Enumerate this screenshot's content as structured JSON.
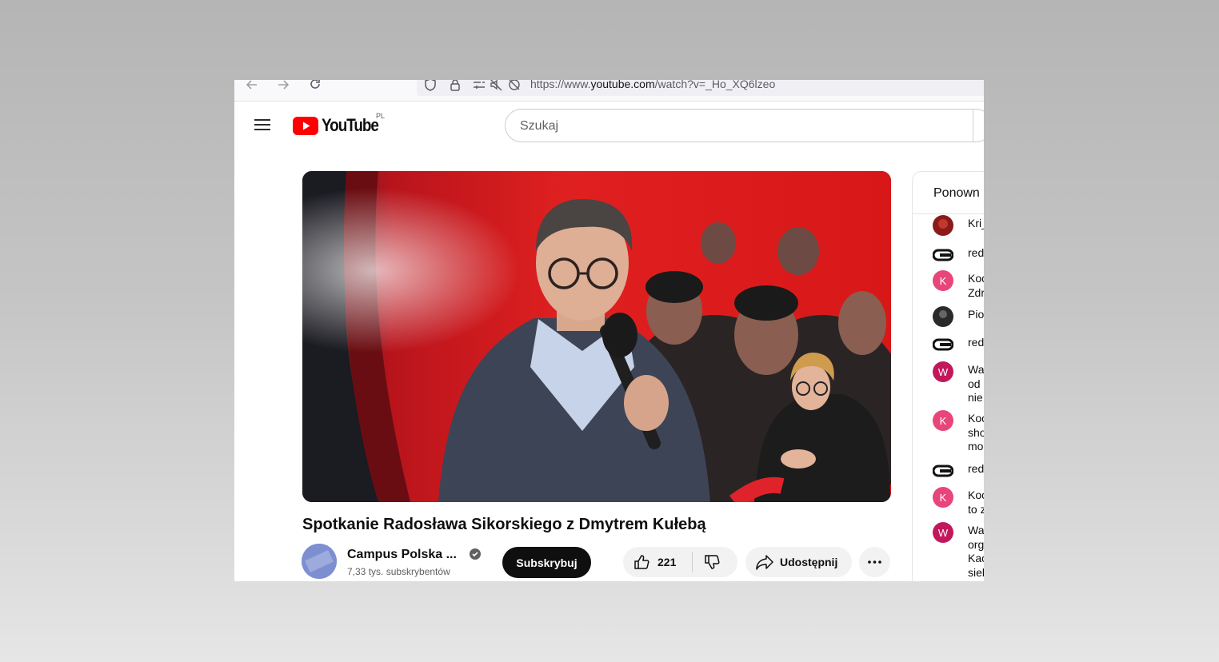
{
  "browser": {
    "url_prefix": "https://www.",
    "url_domain": "youtube.com",
    "url_path": "/watch?v=_Ho_XQ6lzeo"
  },
  "header": {
    "logo_text": "YouTube",
    "country_code": "PL",
    "search_placeholder": "Szukaj"
  },
  "video": {
    "title": "Spotkanie Radosława Sikorskiego z Dmytrem Kułebą"
  },
  "channel": {
    "name": "Campus Polska ...",
    "subscribers": "7,33 tys. subskrybentów",
    "avatar_text": "CAMPUS POLSKA",
    "subscribe_label": "Subskrybuj"
  },
  "actions": {
    "likes": "221",
    "share_label": "Udostępnij"
  },
  "chat": {
    "title": "Ponown",
    "messages": [
      {
        "initial": "",
        "color": "#8b1a1a",
        "lines": [
          "Kri_"
        ]
      },
      {
        "initial": "",
        "color": "#1a1a1a",
        "lines": [
          "red"
        ]
      },
      {
        "initial": "K",
        "color": "#e8457a",
        "lines": [
          "Koc",
          "Zdr"
        ]
      },
      {
        "initial": "",
        "color": "#2a2a2a",
        "lines": [
          "Pio"
        ]
      },
      {
        "initial": "",
        "color": "#1a1a1a",
        "lines": [
          "red"
        ]
      },
      {
        "initial": "W",
        "color": "#c2185b",
        "lines": [
          "Wa",
          "od",
          "nie"
        ]
      },
      {
        "initial": "K",
        "color": "#e8457a",
        "lines": [
          "Koc",
          "sho",
          "mo"
        ]
      },
      {
        "initial": "",
        "color": "#1a1a1a",
        "lines": [
          "red"
        ]
      },
      {
        "initial": "K",
        "color": "#e8457a",
        "lines": [
          "Koc",
          "to z"
        ]
      },
      {
        "initial": "W",
        "color": "#c2185b",
        "lines": [
          "Wa",
          "org",
          "Kac",
          "siel"
        ]
      }
    ]
  }
}
